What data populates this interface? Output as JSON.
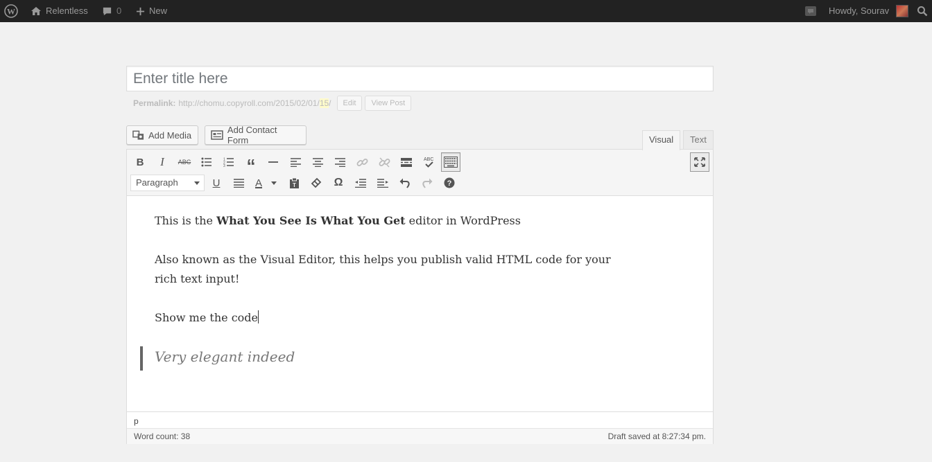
{
  "adminbar": {
    "site_name": "Relentless",
    "comments_count": "0",
    "new_label": "New",
    "howdy": "Howdy, Sourav"
  },
  "title": {
    "placeholder": "Enter title here",
    "value": ""
  },
  "permalink": {
    "label": "Permalink:",
    "url": "http://chomu.copyroll.com/2015/02/01/",
    "slug": "15",
    "trailing": "/",
    "edit_label": "Edit",
    "view_label": "View Post"
  },
  "media_buttons": {
    "add_media": "Add Media",
    "add_contact_form": "Add Contact Form"
  },
  "tabs": {
    "visual": "Visual",
    "text": "Text"
  },
  "toolbar": {
    "format_selected": "Paragraph"
  },
  "content": {
    "p1_before": "This is the ",
    "p1_bold": "What You See Is What You Get",
    "p1_after": " editor in WordPress",
    "p2": "Also known as the Visual Editor, this helps you publish valid HTML code for your rich text input!",
    "p3": "Show me the code",
    "quote": "Very elegant indeed"
  },
  "status": {
    "path": "p",
    "word_count": "Word count: 38",
    "draft_saved": "Draft saved at 8:27:34 pm."
  },
  "colors": {
    "adminbar_bg": "#222222",
    "page_bg": "#f1f1f1",
    "toolbar_bg": "#f5f5f5"
  }
}
